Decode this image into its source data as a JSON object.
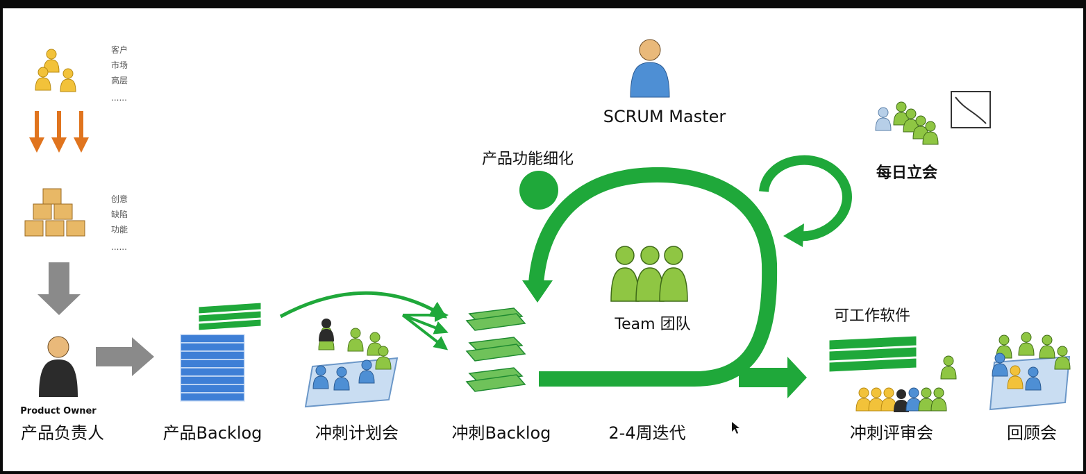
{
  "colors": {
    "background": "#ffffff",
    "green": "#1fa83a",
    "orange": "#e0741e",
    "gray_arrow": "#8a8a8a",
    "person_yellow": "#f2c23a",
    "person_blue": "#4e8fd4",
    "person_green": "#8fc643",
    "person_black": "#2b2b2b"
  },
  "stakeholders": {
    "lines": [
      "客户",
      "市场",
      "高层",
      "......"
    ]
  },
  "inputs": {
    "lines": [
      "创意",
      "缺陷",
      "功能",
      "......"
    ]
  },
  "product_owner": {
    "english": "Product Owner",
    "label": "产品负责人"
  },
  "product_backlog": {
    "label": "产品Backlog"
  },
  "sprint_planning": {
    "label": "冲刺计划会"
  },
  "sprint_backlog": {
    "label": "冲刺Backlog"
  },
  "iteration": {
    "label": "2-4周迭代"
  },
  "scrum_master": {
    "label": "SCRUM Master"
  },
  "refinement": {
    "label": "产品功能细化"
  },
  "daily_standup": {
    "label": "每日立会"
  },
  "team": {
    "label": "Team 团队"
  },
  "working_software": {
    "label": "可工作软件"
  },
  "sprint_review": {
    "label": "冲刺评审会"
  },
  "retrospective": {
    "label": "回顾会"
  },
  "icons": [
    "person-group-icon",
    "package-boxes-icon",
    "person-icon",
    "document-stack-icon",
    "meeting-table-icon",
    "burndown-chart-icon"
  ]
}
